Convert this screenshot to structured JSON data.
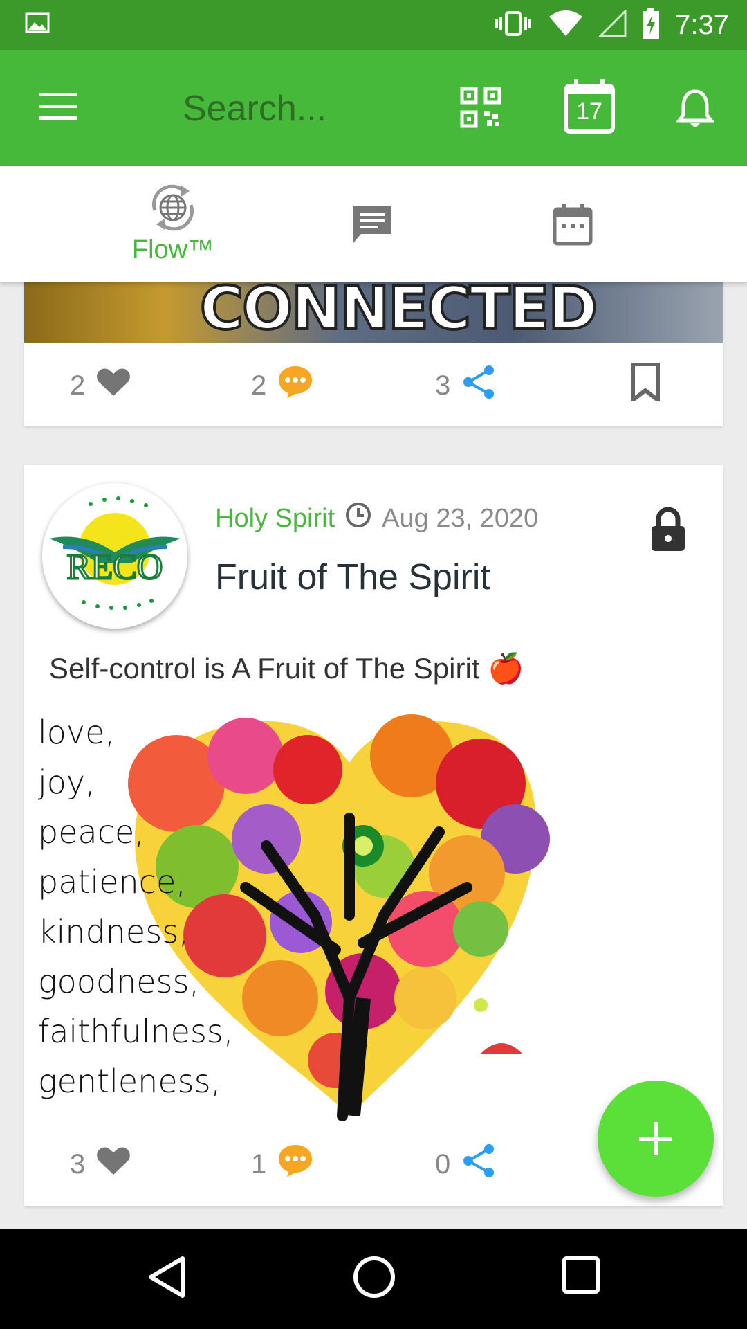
{
  "status_bar": {
    "time": "7:37",
    "icons": [
      "image-notification-icon",
      "vibrate-icon",
      "wifi-icon",
      "signal-icon",
      "battery-charging-icon"
    ]
  },
  "appbar": {
    "search_placeholder": "Search...",
    "calendar_day": "17",
    "icons": [
      "menu-icon",
      "qr-code-icon",
      "calendar-icon",
      "bell-icon"
    ],
    "color": "#46b93a"
  },
  "tabs": [
    {
      "name": "flow",
      "label": "Flow™",
      "icon": "globe-sync-icon",
      "active": true
    },
    {
      "name": "chat",
      "label": "",
      "icon": "chat-icon",
      "active": false
    },
    {
      "name": "events",
      "label": "",
      "icon": "calendar-icon",
      "active": false
    }
  ],
  "posts": [
    {
      "image_text": "CONNECTED",
      "likes": "2",
      "comments": "2",
      "shares": "3"
    },
    {
      "avatar_text": "RECO",
      "category": "Holy Spirit",
      "date": "Aug 23, 2020",
      "title": "Fruit of The Spirit",
      "body": "Self-control is A Fruit of The Spirit 🍎",
      "image_words": [
        "love,",
        "joy,",
        "peace,",
        "patience,",
        "kindness,",
        "goodness,",
        "faithfulness,",
        "gentleness,"
      ],
      "likes": "3",
      "comments": "1",
      "shares": "0"
    }
  ],
  "colors": {
    "brand_green": "#46b93a",
    "status_green": "#3c9a2b",
    "fab_green": "#5be03a",
    "comment_orange": "#f5a623",
    "share_blue": "#2a9df4"
  }
}
